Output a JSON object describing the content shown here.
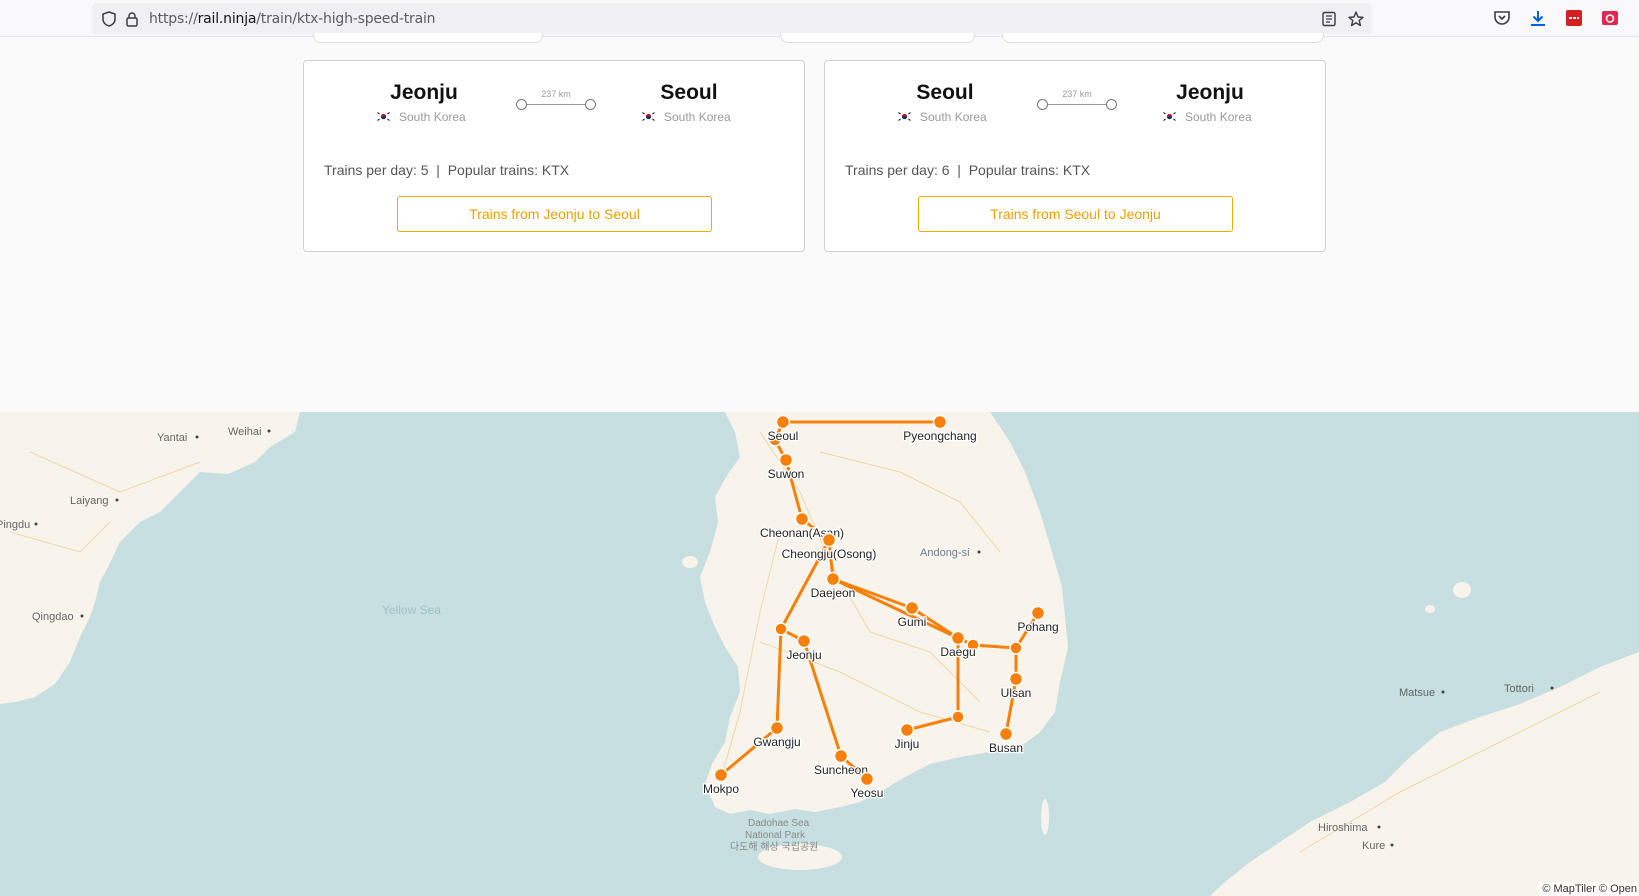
{
  "browser": {
    "url_prefix": "https://",
    "url_host": "rail.ninja",
    "url_path": "/train/ktx-high-speed-train",
    "toolbar_icons": [
      "pocket-icon",
      "download-icon",
      "extension-icon",
      "screenshot-icon"
    ]
  },
  "cards": [
    {
      "from": "Jeonju",
      "from_country": "South Korea",
      "to": "Seoul",
      "to_country": "South Korea",
      "distance": "237 km",
      "stats": "Trains per day: 5  |  Popular trains: KTX",
      "button": "Trains from Jeonju to Seoul"
    },
    {
      "from": "Seoul",
      "from_country": "South Korea",
      "to": "Jeonju",
      "to_country": "South Korea",
      "distance": "237 km",
      "stats": "Trains per day: 6  |  Popular trains: KTX",
      "button": "Trains from Seoul to Jeonju"
    }
  ],
  "map": {
    "route_color": "#f7800a",
    "stations": [
      "Seoul",
      "Pyeongchang",
      "Suwon",
      "Cheonan(Asan)",
      "Cheongju(Osong)",
      "Daejeon",
      "Gumi",
      "Pohang",
      "Daegu",
      "Jeonju",
      "Ulsan",
      "Gwangju",
      "Jinju",
      "Busan",
      "Suncheon",
      "Mokpo",
      "Yeosu"
    ],
    "places": [
      "Yantai",
      "Weihai",
      "Laiyang",
      "Pingdu",
      "Qingdao",
      "Andong-si",
      "Matsue",
      "Tottori",
      "Hiroshima",
      "Kure"
    ],
    "sea_label": "Yellow Sea",
    "park_label_1": "Dadohae Sea",
    "park_label_2": "National Park",
    "park_label_3": "다도해 해상 국립공원",
    "attribution": "© MapTiler © Open"
  }
}
